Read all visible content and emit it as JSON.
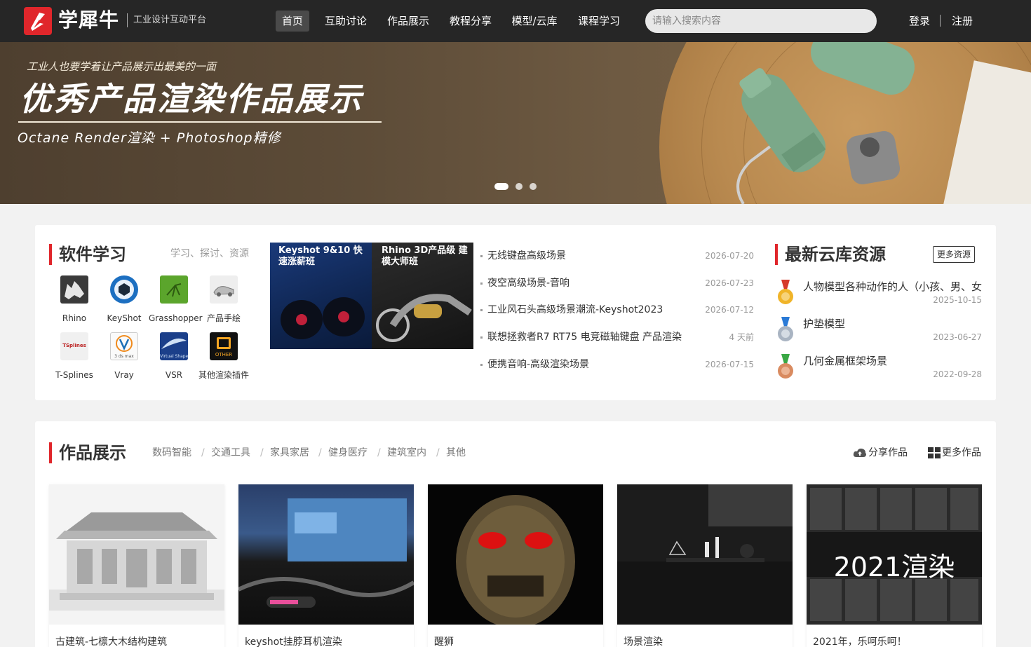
{
  "header": {
    "brand": "学犀牛",
    "subtitle": "工业设计互动平台",
    "nav": [
      "首页",
      "互助讨论",
      "作品展示",
      "教程分享",
      "模型/云库",
      "课程学习"
    ],
    "search_placeholder": "请输入搜索内容",
    "login": "登录",
    "register": "注册"
  },
  "banner": {
    "small_text": "工业人也要学着让产品展示出最美的一面",
    "title": "优秀产品渲染作品展示",
    "subtitle": "Octane Render渲染 + Photoshop精修",
    "slides_total": 3,
    "active_slide": 1
  },
  "software": {
    "title": "软件学习",
    "hint": "学习、探讨、资源",
    "items": [
      "Rhino",
      "KeyShot",
      "Grasshopper",
      "产品手绘",
      "T-Splines",
      "Vray",
      "VSR",
      "其他渲染插件"
    ],
    "icon_names": [
      "rhino-icon",
      "keyshot-icon",
      "grasshopper-icon",
      "hand-sketch-icon",
      "tsplines-icon",
      "vray-icon",
      "vsr-icon",
      "other-plugin-icon"
    ],
    "icon_texts": {
      "tsplines": "TSplines",
      "vray": "3 ds max",
      "vsr": "Virtual Shape",
      "other": "OTHER"
    }
  },
  "ad": {
    "left": "Keyshot 9&10 快速涨薪班",
    "right": "Rhino 3D产品级 建模大师班"
  },
  "news": [
    {
      "title": "无线键盘高级场景",
      "date": "2026-07-20"
    },
    {
      "title": "夜空高级场景-音响",
      "date": "2026-07-23"
    },
    {
      "title": "工业风石头高级场景潮流-Keyshot2023",
      "date": "2026-07-12"
    },
    {
      "title": "联想拯救者R7 RT75 电竞磁轴键盘 产品渲染",
      "date": "4 天前"
    },
    {
      "title": "便携音响-高级渲染场景",
      "date": "2026-07-15"
    }
  ],
  "cloud": {
    "title": "最新云库资源",
    "more": "更多资源",
    "items": [
      {
        "title": "人物模型各种动作的人（小孩、男、女",
        "date": "2025-10-15",
        "medal": "gold"
      },
      {
        "title": "护垫模型",
        "date": "2023-06-27",
        "medal": "silver"
      },
      {
        "title": "几何金属框架场景",
        "date": "2022-09-28",
        "medal": "bronze"
      }
    ]
  },
  "works": {
    "title": "作品展示",
    "categories": [
      "数码智能",
      "交通工具",
      "家具家居",
      "健身医疗",
      "建筑室内",
      "其他"
    ],
    "share": "分享作品",
    "more": "更多作品",
    "cards": [
      {
        "title": "古建筑-七檩大木结构建筑"
      },
      {
        "title": "keyshot挂脖耳机渲染"
      },
      {
        "title": "醒狮"
      },
      {
        "title": "场景渲染"
      },
      {
        "title": "2021年，乐呵乐呵！",
        "overlay": "2021渲染"
      }
    ]
  },
  "colors": {
    "accent": "#e0262b",
    "header_bg": "#262626",
    "page_bg": "#f2f2f2"
  }
}
